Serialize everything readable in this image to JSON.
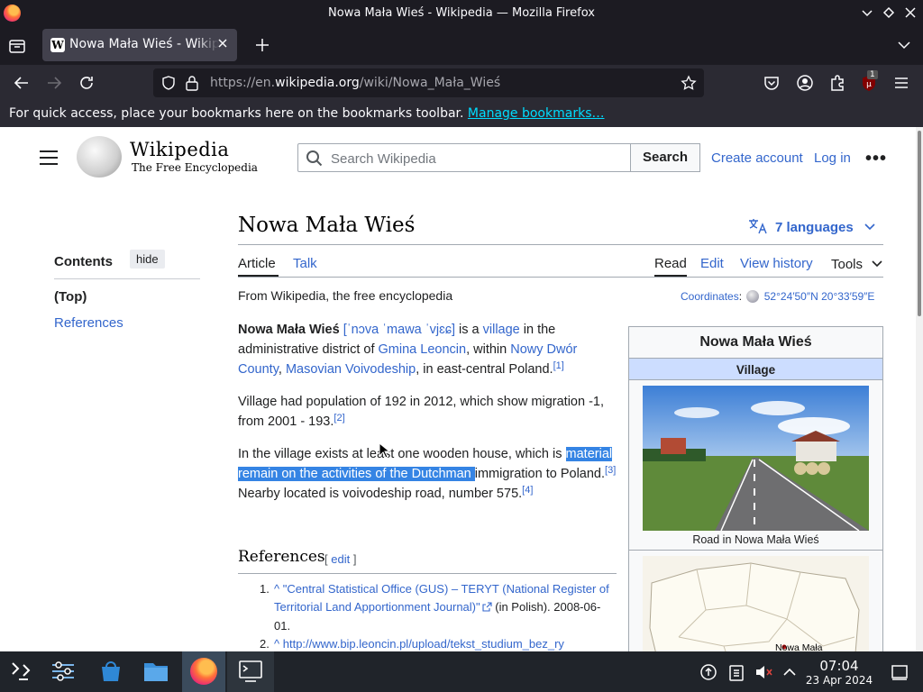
{
  "window": {
    "title": "Nowa Mała Wieś - Wikipedia — Mozilla Firefox"
  },
  "tab": {
    "title": "Nowa Mała Wieś - Wikipedia",
    "favicon": "W"
  },
  "urlbar": {
    "prefix": "https://en.",
    "domain": "wikipedia.org",
    "path": "/wiki/Nowa_Mała_Wieś"
  },
  "bookmarks_bar": {
    "message": "For quick access, place your bookmarks here on the bookmarks toolbar.",
    "link": "Manage bookmarks…"
  },
  "extensions": {
    "ublock_badge": "1"
  },
  "wiki": {
    "wordmark": "Wikipedia",
    "tagline": "The Free Encyclopedia",
    "search_placeholder": "Search Wikipedia",
    "search_button": "Search",
    "create_account": "Create account",
    "log_in": "Log in",
    "more": "•••"
  },
  "toc": {
    "title": "Contents",
    "hide": "hide",
    "items": [
      "(Top)",
      "References"
    ]
  },
  "article": {
    "title": "Nowa Mała Wieś",
    "languages": "7 languages",
    "tabs_left": [
      "Article",
      "Talk"
    ],
    "tabs_right": [
      "Read",
      "Edit",
      "View history",
      "Tools"
    ],
    "from": "From Wikipedia, the free encyclopedia",
    "coords_label": "Coordinates",
    "coords_value": "52°24′50″N 20°33′59″E",
    "p1": {
      "bold": "Nowa Mała Wieś",
      "ipa": "[ˈnɔva ˈmawa ˈvjɛɕ]",
      "t1": " is a ",
      "village": "village",
      "t2": " in the administrative district of ",
      "gmina": "Gmina Leoncin",
      "t3": ", within ",
      "county": "Nowy Dwór County",
      "t4": ", ",
      "voiv": "Masovian Voivodeship",
      "t5": ", in east-central Poland.",
      "ref": "[1]"
    },
    "p2": {
      "text": "Village had population of 192 in 2012, which show migration -1, from 2001 - 193.",
      "ref": "[2]"
    },
    "p3": {
      "t1": "In the village exists at least one wooden house, which is ",
      "highlight": "material remain on the activities of the Dutchman ",
      "t2": "immigration to Poland.",
      "ref3": "[3]",
      "t3": " Nearby located is voivodeship road, number 575.",
      "ref4": "[4]"
    },
    "references_heading": "References",
    "references_edit_open": "[ ",
    "references_edit": "edit",
    "references_edit_close": " ]",
    "refs": [
      {
        "num": "1.",
        "caret": "^",
        "link": "\"Central Statistical Office (GUS) – TERYT (National Register of Territorial Land Apportionment Journal)\"",
        "after": " (in Polish). 2008-06-01."
      },
      {
        "num": "2.",
        "caret": "^",
        "link": "http://www.bip.leoncin.pl/upload/tekst_studium_bez_ry",
        "after": ""
      }
    ]
  },
  "infobox": {
    "title": "Nowa Mała Wieś",
    "subtitle": "Village",
    "caption": "Road in Nowa Mała Wieś",
    "map_label": "Nowa Mała"
  },
  "taskbar": {
    "time": "07:04",
    "date": "23 Apr 2024"
  }
}
